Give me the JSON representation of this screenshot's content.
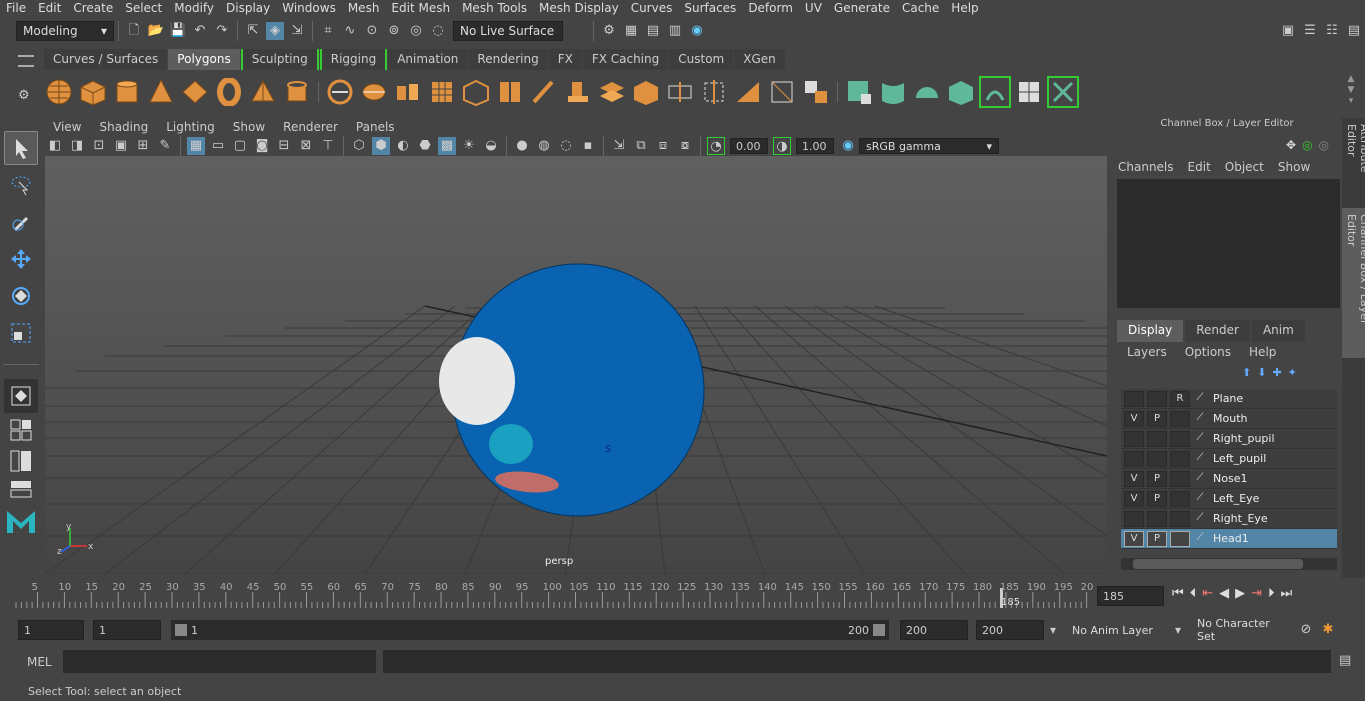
{
  "menus": [
    "File",
    "Edit",
    "Create",
    "Select",
    "Modify",
    "Display",
    "Windows",
    "Mesh",
    "Edit Mesh",
    "Mesh Tools",
    "Mesh Display",
    "Curves",
    "Surfaces",
    "Deform",
    "UV",
    "Generate",
    "Cache",
    "Help"
  ],
  "status": {
    "workspace": "Modeling",
    "live_surface": "No Live Surface"
  },
  "shelf_tabs": [
    "Curves / Surfaces",
    "Polygons",
    "Sculpting",
    "Rigging",
    "Animation",
    "Rendering",
    "FX",
    "FX Caching",
    "Custom",
    "XGen"
  ],
  "shelf_active": "Polygons",
  "panel_menus": [
    "View",
    "Shading",
    "Lighting",
    "Show",
    "Renderer",
    "Panels"
  ],
  "panel_bar": {
    "exposure": "0.00",
    "gamma": "1.00",
    "color_space": "sRGB gamma"
  },
  "viewport": {
    "camera_label": "persp",
    "marker": "s"
  },
  "channel_box": {
    "title": "Channel Box / Layer Editor",
    "menus": [
      "Channels",
      "Edit",
      "Object",
      "Show"
    ]
  },
  "layer_editor": {
    "tabs": [
      "Display",
      "Render",
      "Anim"
    ],
    "menus": [
      "Layers",
      "Options",
      "Help"
    ],
    "layers": [
      {
        "v": "",
        "p": "",
        "r": "R",
        "name": "Plane",
        "selected": false
      },
      {
        "v": "V",
        "p": "P",
        "r": "",
        "name": "Mouth",
        "selected": false
      },
      {
        "v": "",
        "p": "",
        "r": "",
        "name": "Right_pupil",
        "selected": false
      },
      {
        "v": "",
        "p": "",
        "r": "",
        "name": "Left_pupil",
        "selected": false
      },
      {
        "v": "V",
        "p": "P",
        "r": "",
        "name": "Nose1",
        "selected": false
      },
      {
        "v": "V",
        "p": "P",
        "r": "",
        "name": "Left_Eye",
        "selected": false
      },
      {
        "v": "",
        "p": "",
        "r": "",
        "name": "Right_Eye",
        "selected": false
      },
      {
        "v": "V",
        "p": "P",
        "r": "",
        "name": "Head1",
        "selected": true
      }
    ]
  },
  "right_tabs": [
    "Attribute Editor",
    "Channel Box / Layer Editor"
  ],
  "timeline": {
    "ticks": [
      "5",
      "10",
      "15",
      "20",
      "25",
      "30",
      "35",
      "40",
      "45",
      "50",
      "55",
      "60",
      "65",
      "70",
      "75",
      "80",
      "85",
      "90",
      "95",
      "100",
      "105",
      "110",
      "115",
      "120",
      "125",
      "130",
      "135",
      "140",
      "145",
      "150",
      "155",
      "160",
      "165",
      "170",
      "175",
      "180",
      "185",
      "190",
      "195",
      "20"
    ],
    "current": "185",
    "current_field": "185"
  },
  "range": {
    "start": "1",
    "playback_start": "1",
    "slider_start": "1",
    "slider_end": "200",
    "playback_end": "200",
    "end": "200",
    "anim_layer": "No Anim Layer",
    "char_set": "No Character Set"
  },
  "cmd": {
    "label": "MEL"
  },
  "help": "Select Tool: select an object"
}
